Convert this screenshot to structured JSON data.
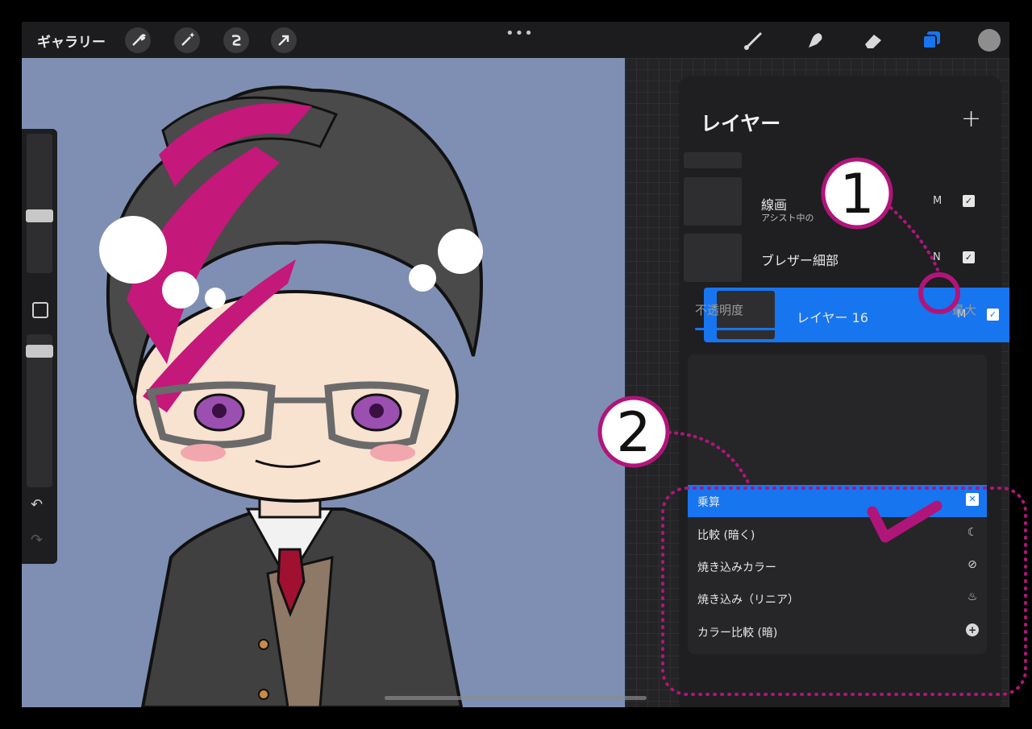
{
  "topbar": {
    "gallery_label": "ギャラリー",
    "more_dots": "•••",
    "tools": [
      "wrench-icon",
      "magic-wand-icon",
      "selection-icon",
      "transform-arrow-icon",
      "brush-icon",
      "smudge-icon",
      "eraser-icon",
      "layers-icon"
    ]
  },
  "sidebar": {
    "icons": [
      "undo-icon",
      "redo-icon"
    ]
  },
  "layers_panel": {
    "title": "レイヤー",
    "add_label": "+",
    "layers": [
      {
        "name": "線画",
        "subtitle": "アシスト中の",
        "mode": "M",
        "visible": "✓"
      },
      {
        "name": "ブレザー細部",
        "subtitle": "",
        "mode": "N",
        "visible": "✓"
      },
      {
        "name": "レイヤー 16",
        "subtitle": "",
        "mode": "M",
        "visible": "✓"
      }
    ],
    "opacity_label": "不透明度",
    "opacity_max_label": "最大",
    "opacity": 1.0
  },
  "blend_modes": {
    "items": [
      {
        "label": "乗算",
        "icon": "multiply-icon",
        "selected": true
      },
      {
        "label": "比較 (暗く)",
        "icon": "moon-icon",
        "selected": false
      },
      {
        "label": "焼き込みカラー",
        "icon": "burn-icon",
        "selected": false
      },
      {
        "label": "焼き込み（リニア）",
        "icon": "flame-icon",
        "selected": false
      },
      {
        "label": "カラー比較 (暗)",
        "icon": "plus-circle-icon",
        "selected": false
      }
    ]
  },
  "annotations": {
    "marker_1": "1",
    "marker_2": "2"
  },
  "colors": {
    "accent": "#1775f0",
    "annotation": "#b0157a",
    "canvas_bg": "#7f8fb3",
    "hair_highlight": "#c4187a"
  }
}
